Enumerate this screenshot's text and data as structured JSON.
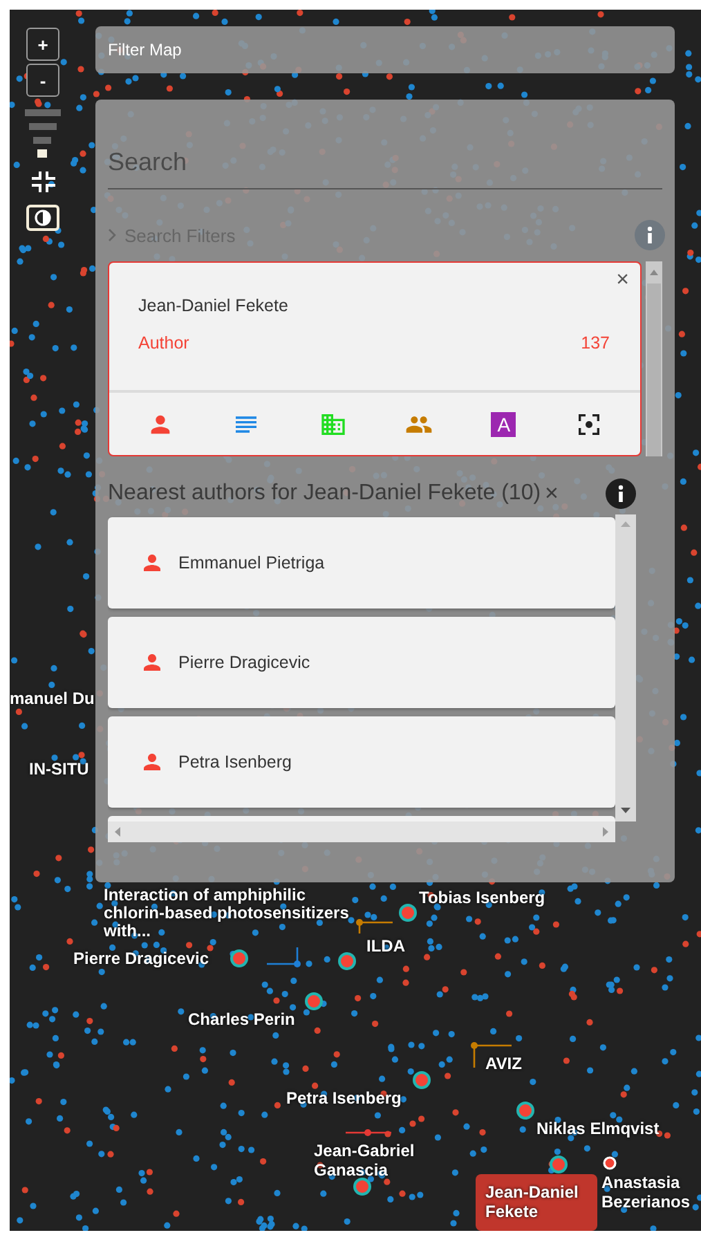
{
  "controls": {
    "zoom_in": "+",
    "zoom_out": "-"
  },
  "filter_bar": {
    "label": "Filter Map"
  },
  "search": {
    "placeholder": "Search"
  },
  "search_filters": {
    "label": "Search Filters",
    "expanded": false
  },
  "entity_card": {
    "name": "Jean-Daniel Fekete",
    "type": "Author",
    "count": "137",
    "close": "×",
    "type_buttons": [
      {
        "kind": "author",
        "color": "#f44336"
      },
      {
        "kind": "document",
        "color": "#1e88e5"
      },
      {
        "kind": "organization",
        "color": "#22dd22"
      },
      {
        "kind": "group",
        "color": "#c67c00"
      },
      {
        "kind": "topic",
        "color": "#9c27b0",
        "label": "A"
      },
      {
        "kind": "focus",
        "color": "#212121"
      }
    ]
  },
  "nearest": {
    "title": "Nearest authors for Jean-Daniel Fekete (10)",
    "close": "×",
    "items": [
      {
        "kind": "author",
        "name": "Emmanuel Pietriga"
      },
      {
        "kind": "author",
        "name": "Pierre Dragicevic"
      },
      {
        "kind": "author",
        "name": "Petra Isenberg"
      }
    ]
  },
  "map": {
    "labels": [
      {
        "kind": "author",
        "text": "manuel Du"
      },
      {
        "kind": "group",
        "text": "IN-SITU"
      },
      {
        "kind": "paper",
        "text": "Interaction of amphiphilic chlorin-based photosensitizers with..."
      },
      {
        "kind": "author",
        "text": "Tobias Isenberg"
      },
      {
        "kind": "group",
        "text": "ILDA"
      },
      {
        "kind": "author",
        "text": "Pierre Dragicevic"
      },
      {
        "kind": "author",
        "text": "Charles Perin"
      },
      {
        "kind": "group",
        "text": "AVIZ"
      },
      {
        "kind": "author",
        "text": "Petra Isenberg"
      },
      {
        "kind": "author",
        "text": "Jean-Gabriel Ganascia"
      },
      {
        "kind": "author",
        "text": "Niklas Elmqvist"
      },
      {
        "kind": "selected",
        "text": "Jean-Daniel Fekete"
      },
      {
        "kind": "author",
        "text": "Anastasia Bezerianos"
      }
    ]
  }
}
